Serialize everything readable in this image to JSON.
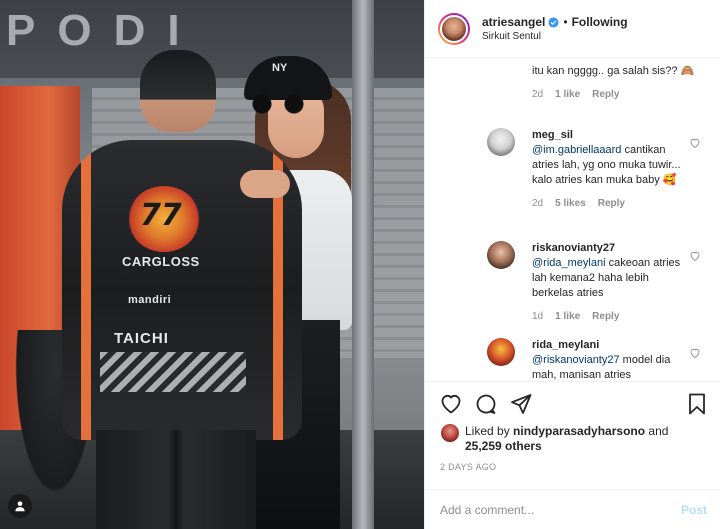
{
  "photo": {
    "banner_text": "PODI",
    "cap_logo": "NY",
    "suit": {
      "number": "77",
      "text1": "CARGLOSS",
      "text2": "mandiri",
      "text3": "TAICHI"
    }
  },
  "header": {
    "username": "atriesangel",
    "separator": "•",
    "follow_status": "Following",
    "location": "Sirkuit Sentul"
  },
  "comments": {
    "first_tail": {
      "text": "itu kan ngggg.. ga salah sis?? 🙈",
      "age": "2d",
      "likes": "1 like",
      "reply": "Reply"
    },
    "items": [
      {
        "user": "meg_sil",
        "mention": "@im.gabriellaaard",
        "text": " cantikan atries lah, yg ono muka tuwir... kalo atries kan muka baby 🥰",
        "age": "2d",
        "likes": "5 likes",
        "reply": "Reply"
      },
      {
        "user": "riskanovianty27",
        "mention": "@rida_meylani",
        "text": " cakeoan atries lah kemana2 haha lebih berkelas atries",
        "age": "1d",
        "likes": "1 like",
        "reply": "Reply"
      },
      {
        "user": "rida_meylani",
        "mention": "@riskanovianty27",
        "text": " model dia mah, manisan atries",
        "age": "",
        "likes": "",
        "reply": ""
      }
    ]
  },
  "actions": {
    "liked_by_prefix": "Liked by ",
    "liked_by_user": "nindyparasadyharsono",
    "and": " and",
    "others": "25,259 others",
    "date": "2 DAYS AGO",
    "comment_placeholder": "Add a comment...",
    "post_label": "Post"
  },
  "colors": {
    "text": "#262626",
    "muted": "#8e8e8e",
    "mention": "#00376b",
    "post_disabled": "#b2dffc",
    "verified": "#3897f0"
  }
}
